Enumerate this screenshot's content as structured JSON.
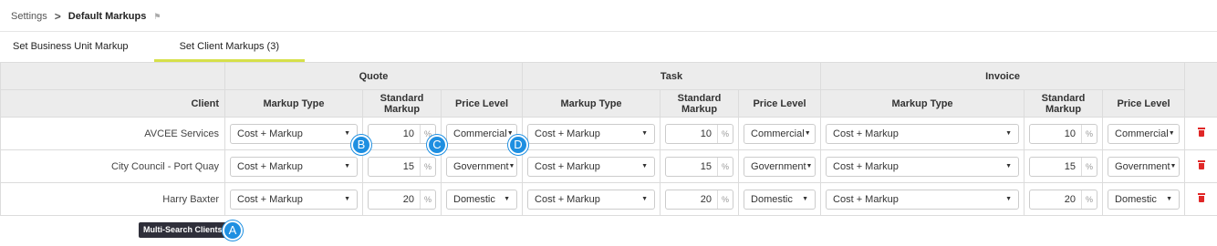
{
  "breadcrumb": {
    "root": "Settings",
    "separator": ">",
    "current": "Default Markups",
    "icon": "bookmark-icon"
  },
  "tabs": [
    {
      "label": "Set Business Unit Markup",
      "active": false
    },
    {
      "label": "Set Client Markups (3)",
      "active": true
    }
  ],
  "table": {
    "groups": [
      "Quote",
      "Task",
      "Invoice"
    ],
    "columns": {
      "client": "Client",
      "markup_type": "Markup Type",
      "standard_markup": "Standard Markup",
      "price_level": "Price Level"
    },
    "percent_symbol": "%",
    "rows": [
      {
        "client": "AVCEE Services",
        "quote": {
          "markup_type": "Cost + Markup",
          "standard_markup": "10",
          "price_level": "Commercial"
        },
        "task": {
          "markup_type": "Cost + Markup",
          "standard_markup": "10",
          "price_level": "Commercial"
        },
        "invoice": {
          "markup_type": "Cost + Markup",
          "standard_markup": "10",
          "price_level": "Commercial"
        }
      },
      {
        "client": "City Council - Port Quay",
        "quote": {
          "markup_type": "Cost + Markup",
          "standard_markup": "15",
          "price_level": "Government"
        },
        "task": {
          "markup_type": "Cost + Markup",
          "standard_markup": "15",
          "price_level": "Government"
        },
        "invoice": {
          "markup_type": "Cost + Markup",
          "standard_markup": "15",
          "price_level": "Government"
        }
      },
      {
        "client": "Harry Baxter",
        "quote": {
          "markup_type": "Cost + Markup",
          "standard_markup": "20",
          "price_level": "Domestic"
        },
        "task": {
          "markup_type": "Cost + Markup",
          "standard_markup": "20",
          "price_level": "Domestic"
        },
        "invoice": {
          "markup_type": "Cost + Markup",
          "standard_markup": "20",
          "price_level": "Domestic"
        }
      }
    ]
  },
  "multi_search_button": "Multi-Search Clients",
  "callouts": [
    "A",
    "B",
    "C",
    "D"
  ],
  "colors": {
    "tab_underline": "#d6e04a",
    "callout": "#1e8fe1",
    "delete": "#e02727",
    "button_bg": "#2f2f3a",
    "header_bg": "#ececec"
  }
}
